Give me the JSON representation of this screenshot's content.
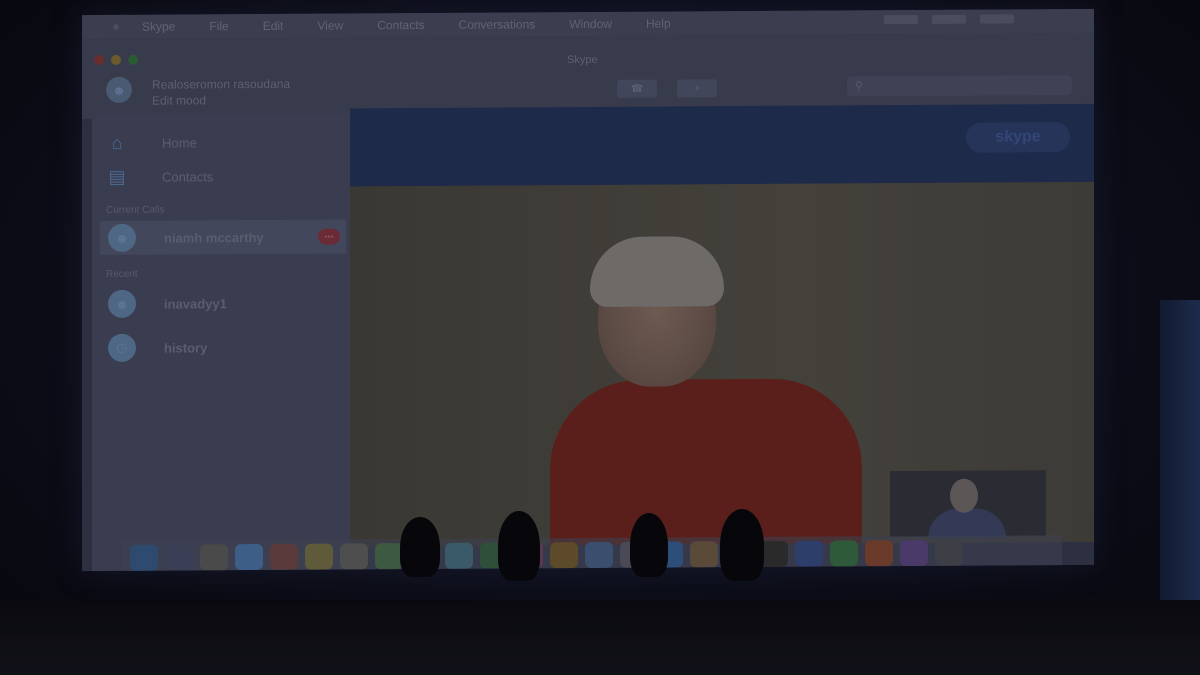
{
  "menubar": {
    "items": [
      "Skype",
      "File",
      "Edit",
      "View",
      "Contacts",
      "Conversations",
      "Window",
      "Help"
    ]
  },
  "titlebar": {
    "title": "Skype",
    "profile_line1": "Realoseromon rasoudana",
    "profile_line2": "Edit mood"
  },
  "sidebar": {
    "nav": [
      {
        "label": "Home",
        "icon": "home-icon"
      },
      {
        "label": "Contacts",
        "icon": "contacts-icon"
      }
    ],
    "sections": {
      "current_calls": "Current Calls",
      "recent": "Recent"
    },
    "current_calls": [
      {
        "name": "niamh mccarthy",
        "badge": "•••"
      }
    ],
    "recent": [
      {
        "name": "inavadyy1"
      },
      {
        "name": "history"
      }
    ]
  },
  "video_header": {
    "logo": "skype"
  },
  "colors": {
    "accent": "#1e2a4a",
    "badge": "#6a2a36",
    "shirt": "#5a1f1b"
  },
  "dock": {
    "icons": [
      "finder-icon",
      "launchpad-icon",
      "safari-icon",
      "mail-icon",
      "calendar-icon",
      "notes-icon",
      "reminders-icon",
      "maps-icon",
      "photos-icon",
      "messages-icon",
      "facetime-icon",
      "music-icon",
      "ibooks-icon",
      "app-store-icon",
      "preferences-icon",
      "skype-icon",
      "chrome-icon",
      "firefox-icon",
      "terminal-icon",
      "word-icon",
      "excel-icon",
      "powerpoint-icon",
      "itunes-icon",
      "trash-icon"
    ]
  }
}
